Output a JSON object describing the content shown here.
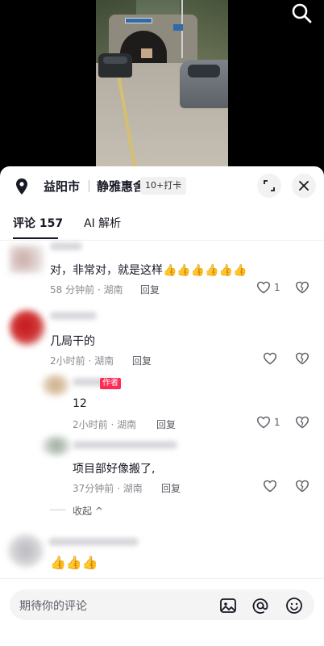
{
  "video": {
    "search_icon": "search-icon"
  },
  "location": {
    "city": "益阳市",
    "place": "静雅惠舍",
    "badge": "10+打卡",
    "pin_icon": "location-pin-icon"
  },
  "tabs": [
    {
      "label": "评论 157",
      "active": true
    },
    {
      "label": "AI 解析",
      "active": false
    }
  ],
  "comments": [
    {
      "text": "对，非常对，就是这样👍👍👍👍👍👍",
      "meta": "58 分钟前 · 湖南",
      "reply": "回复",
      "likes": "1"
    },
    {
      "text": "几局干的",
      "meta": "2小时前 · 湖南",
      "reply": "回复",
      "likes": ""
    }
  ],
  "replies": [
    {
      "badge": "作者",
      "text": "12",
      "meta": "2小时前 · 湖南",
      "reply": "回复",
      "likes": "1"
    },
    {
      "text": "项目部好像搬了,",
      "meta": "37分钟前 · 湖南",
      "reply": "回复",
      "likes": ""
    }
  ],
  "collapse_label": "收起",
  "last_comment": {
    "text": "👍👍👍"
  },
  "input": {
    "placeholder": "期待你的评论"
  },
  "colors": {
    "accent": "#fe2c55",
    "text": "#161823",
    "meta": "#8a8b91"
  }
}
